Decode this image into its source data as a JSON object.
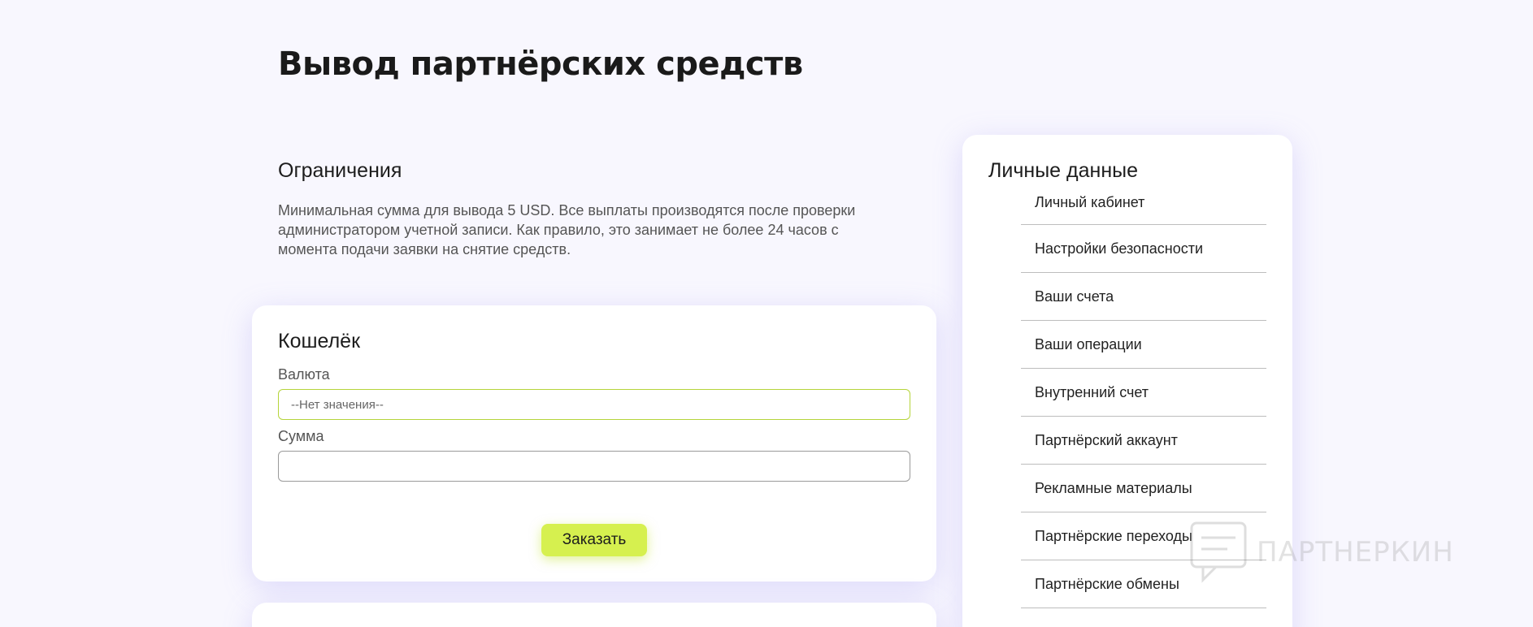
{
  "page": {
    "title": "Вывод партнёрских средств"
  },
  "limits": {
    "heading": "Ограничения",
    "text": "Минимальная сумма для вывода 5 USD. Все выплаты производятся после проверки администратором учетной записи. Как правило, это занимает не более 24 часов с момента подачи заявки на снятие средств."
  },
  "wallet": {
    "heading": "Кошелёк",
    "currency_label": "Валюта",
    "currency_value": "--Нет значения--",
    "amount_label": "Сумма",
    "amount_value": "",
    "submit_label": "Заказать"
  },
  "sidebar": {
    "heading": "Личные данные",
    "items": [
      {
        "label": "Личный кабинет"
      },
      {
        "label": "Настройки безопасности"
      },
      {
        "label": "Ваши счета"
      },
      {
        "label": "Ваши операции"
      },
      {
        "label": "Внутренний счет"
      },
      {
        "label": "Партнёрский аккаунт"
      },
      {
        "label": "Рекламные материалы"
      },
      {
        "label": "Партнёрские переходы"
      },
      {
        "label": "Партнёрские обмены"
      }
    ]
  },
  "watermark": {
    "text": "ПАРТНЕРКИН",
    "icon": "chat-bubble-icon"
  },
  "colors": {
    "background": "#f8f7fe",
    "accent": "#d6f04f",
    "active_border": "#b5d43a"
  }
}
